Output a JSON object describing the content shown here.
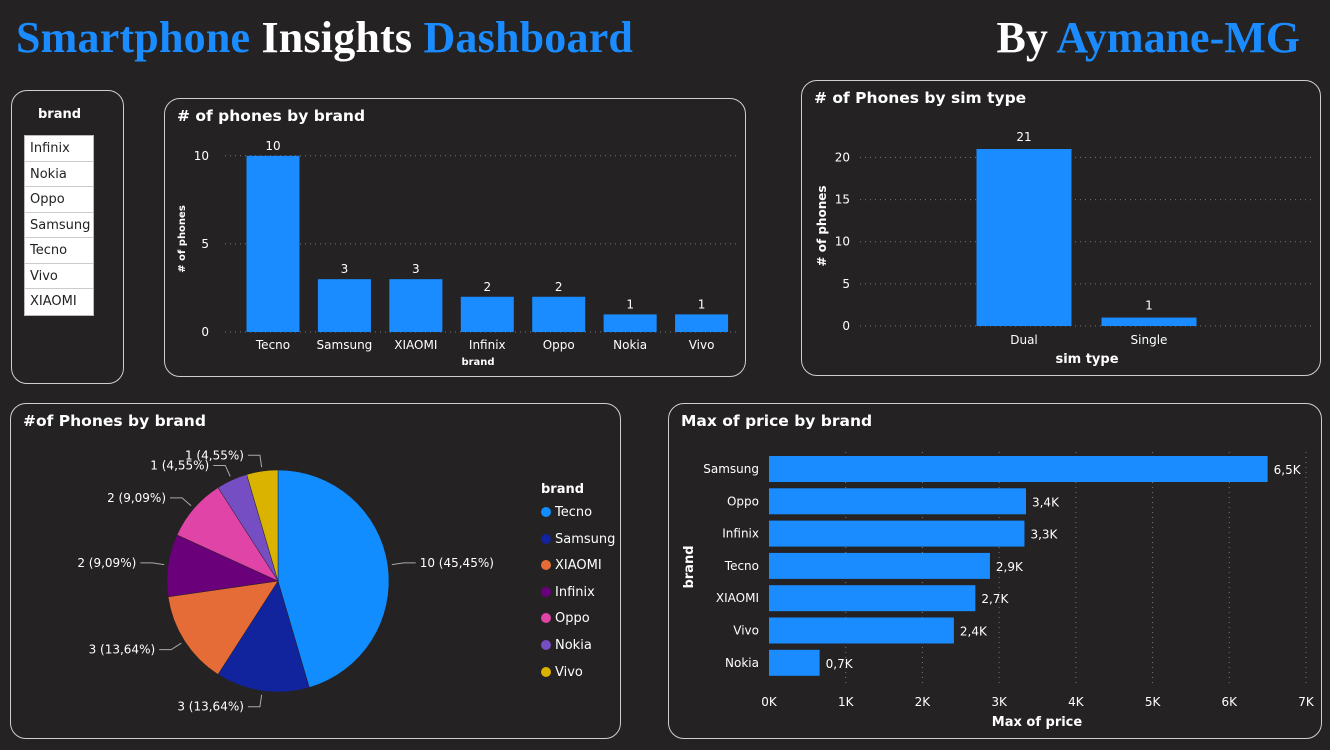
{
  "header": {
    "title_part1": "Smartphone",
    "title_part2": "Insights",
    "title_part3": "Dashboard",
    "author_prefix": "By",
    "author_name": "Aymane-MG"
  },
  "colors": {
    "accent": "#1a8cff",
    "background": "#242222",
    "pie": [
      "#118dff",
      "#12239e",
      "#e66c37",
      "#6b007b",
      "#e044a7",
      "#744ec2",
      "#d9b300"
    ]
  },
  "slicer": {
    "title": "brand",
    "items": [
      "Infinix",
      "Nokia",
      "Oppo",
      "Samsung",
      "Tecno",
      "Vivo",
      "XIAOMI"
    ]
  },
  "chart_data": [
    {
      "id": "phones_by_brand",
      "type": "bar",
      "title": "# of phones by brand",
      "xlabel": "brand",
      "ylabel": "# of phones",
      "categories": [
        "Tecno",
        "Samsung",
        "XIAOMI",
        "Infinix",
        "Oppo",
        "Nokia",
        "Vivo"
      ],
      "values": [
        10,
        3,
        3,
        2,
        2,
        1,
        1
      ],
      "yticks": [
        0,
        5,
        10
      ],
      "ylim": [
        0,
        10.5
      ],
      "grid": true
    },
    {
      "id": "phones_by_sim",
      "type": "bar",
      "title": "# of Phones by sim type",
      "xlabel": "sim type",
      "ylabel": "# of phones",
      "categories": [
        "Dual",
        "Single"
      ],
      "values": [
        21,
        1
      ],
      "yticks": [
        0,
        5,
        10,
        15,
        20
      ],
      "ylim": [
        0,
        21
      ],
      "grid": true
    },
    {
      "id": "phones_by_brand_pie",
      "type": "pie",
      "title": "#of Phones by brand",
      "legend_title": "brand",
      "legend_position": "right",
      "labels": [
        "Tecno",
        "Samsung",
        "XIAOMI",
        "Infinix",
        "Oppo",
        "Nokia",
        "Vivo"
      ],
      "values": [
        10,
        3,
        3,
        2,
        2,
        1,
        1
      ],
      "data_labels": [
        "10 (45,45%)",
        "3 (13,64%)",
        "3 (13,64%)",
        "2 (9,09%)",
        "2 (9,09%)",
        "1 (4,55%)",
        "1 (4,55%)"
      ]
    },
    {
      "id": "max_price_by_brand",
      "type": "bar",
      "orientation": "horizontal",
      "title": "Max of price by brand",
      "xlabel": "Max of price",
      "ylabel": "brand",
      "categories": [
        "Samsung",
        "Oppo",
        "Infinix",
        "Tecno",
        "XIAOMI",
        "Vivo",
        "Nokia"
      ],
      "values": [
        6500,
        3350,
        3330,
        2880,
        2690,
        2410,
        660
      ],
      "data_labels": [
        "6,5K",
        "3,4K",
        "3,3K",
        "2,9K",
        "2,7K",
        "2,4K",
        "0,7K"
      ],
      "xticks": [
        "0K",
        "1K",
        "2K",
        "3K",
        "4K",
        "5K",
        "6K",
        "7K"
      ],
      "xlim": [
        0,
        7000
      ],
      "grid": true
    }
  ]
}
